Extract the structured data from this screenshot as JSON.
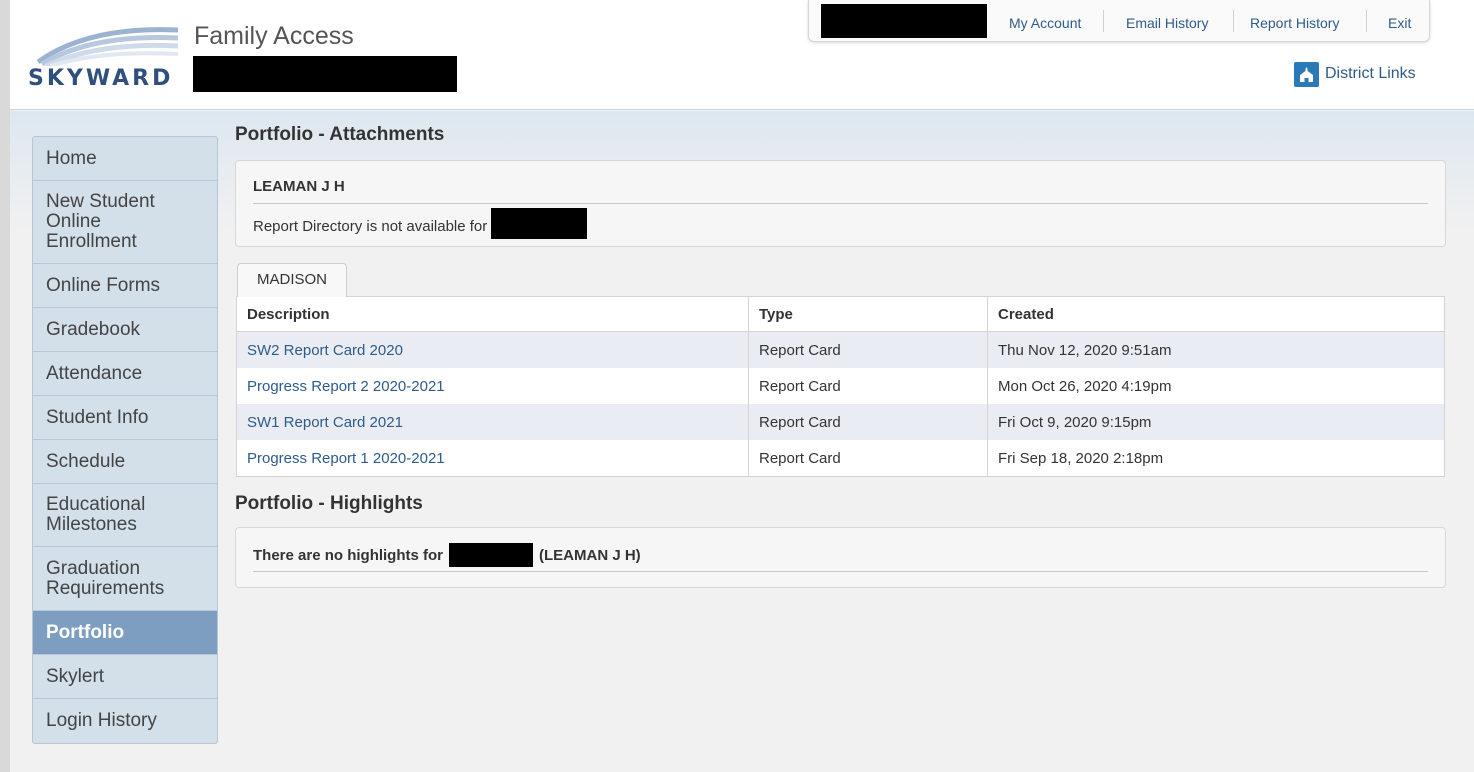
{
  "app": {
    "brand": "SKYWARD",
    "title": "Family Access"
  },
  "top_links": {
    "my_account": "My Account",
    "email_history": "Email History",
    "report_history": "Report History",
    "exit": "Exit"
  },
  "district_links": {
    "label": "District Links",
    "icon": "school-building-icon"
  },
  "sidebar": {
    "items": [
      {
        "label": "Home",
        "active": false
      },
      {
        "label": "New Student Online Enrollment",
        "active": false
      },
      {
        "label": "Online Forms",
        "active": false
      },
      {
        "label": "Gradebook",
        "active": false
      },
      {
        "label": "Attendance",
        "active": false
      },
      {
        "label": "Student Info",
        "active": false
      },
      {
        "label": "Schedule",
        "active": false
      },
      {
        "label": "Educational Milestones",
        "active": false
      },
      {
        "label": "Graduation Requirements",
        "active": false
      },
      {
        "label": "Portfolio",
        "active": true
      },
      {
        "label": "Skylert",
        "active": false
      },
      {
        "label": "Login History",
        "active": false
      }
    ]
  },
  "attachments": {
    "title": "Portfolio - Attachments",
    "school_header": "LEAMAN J H",
    "notice_prefix": "Report Directory is not available for",
    "tab_label": "MADISON",
    "columns": [
      "Description",
      "Type",
      "Created"
    ],
    "rows": [
      {
        "description": "SW2 Report Card 2020",
        "type": "Report Card",
        "created": "Thu Nov 12, 2020 9:51am"
      },
      {
        "description": "Progress Report 2 2020-2021",
        "type": "Report Card",
        "created": "Mon Oct 26, 2020 4:19pm"
      },
      {
        "description": "SW1 Report Card 2021",
        "type": "Report Card",
        "created": "Fri Oct 9, 2020 9:15pm"
      },
      {
        "description": "Progress Report 1 2020-2021",
        "type": "Report Card",
        "created": "Fri Sep 18, 2020 2:18pm"
      }
    ]
  },
  "highlights": {
    "title": "Portfolio - Highlights",
    "text_prefix": "There are no highlights for",
    "text_suffix": "(LEAMAN J H)"
  },
  "colors": {
    "link": "#2e5b8a",
    "nav_active": "#7d9ec0",
    "sidebar_bg": "#d3dfe9",
    "row_alt": "#e9edf3"
  }
}
